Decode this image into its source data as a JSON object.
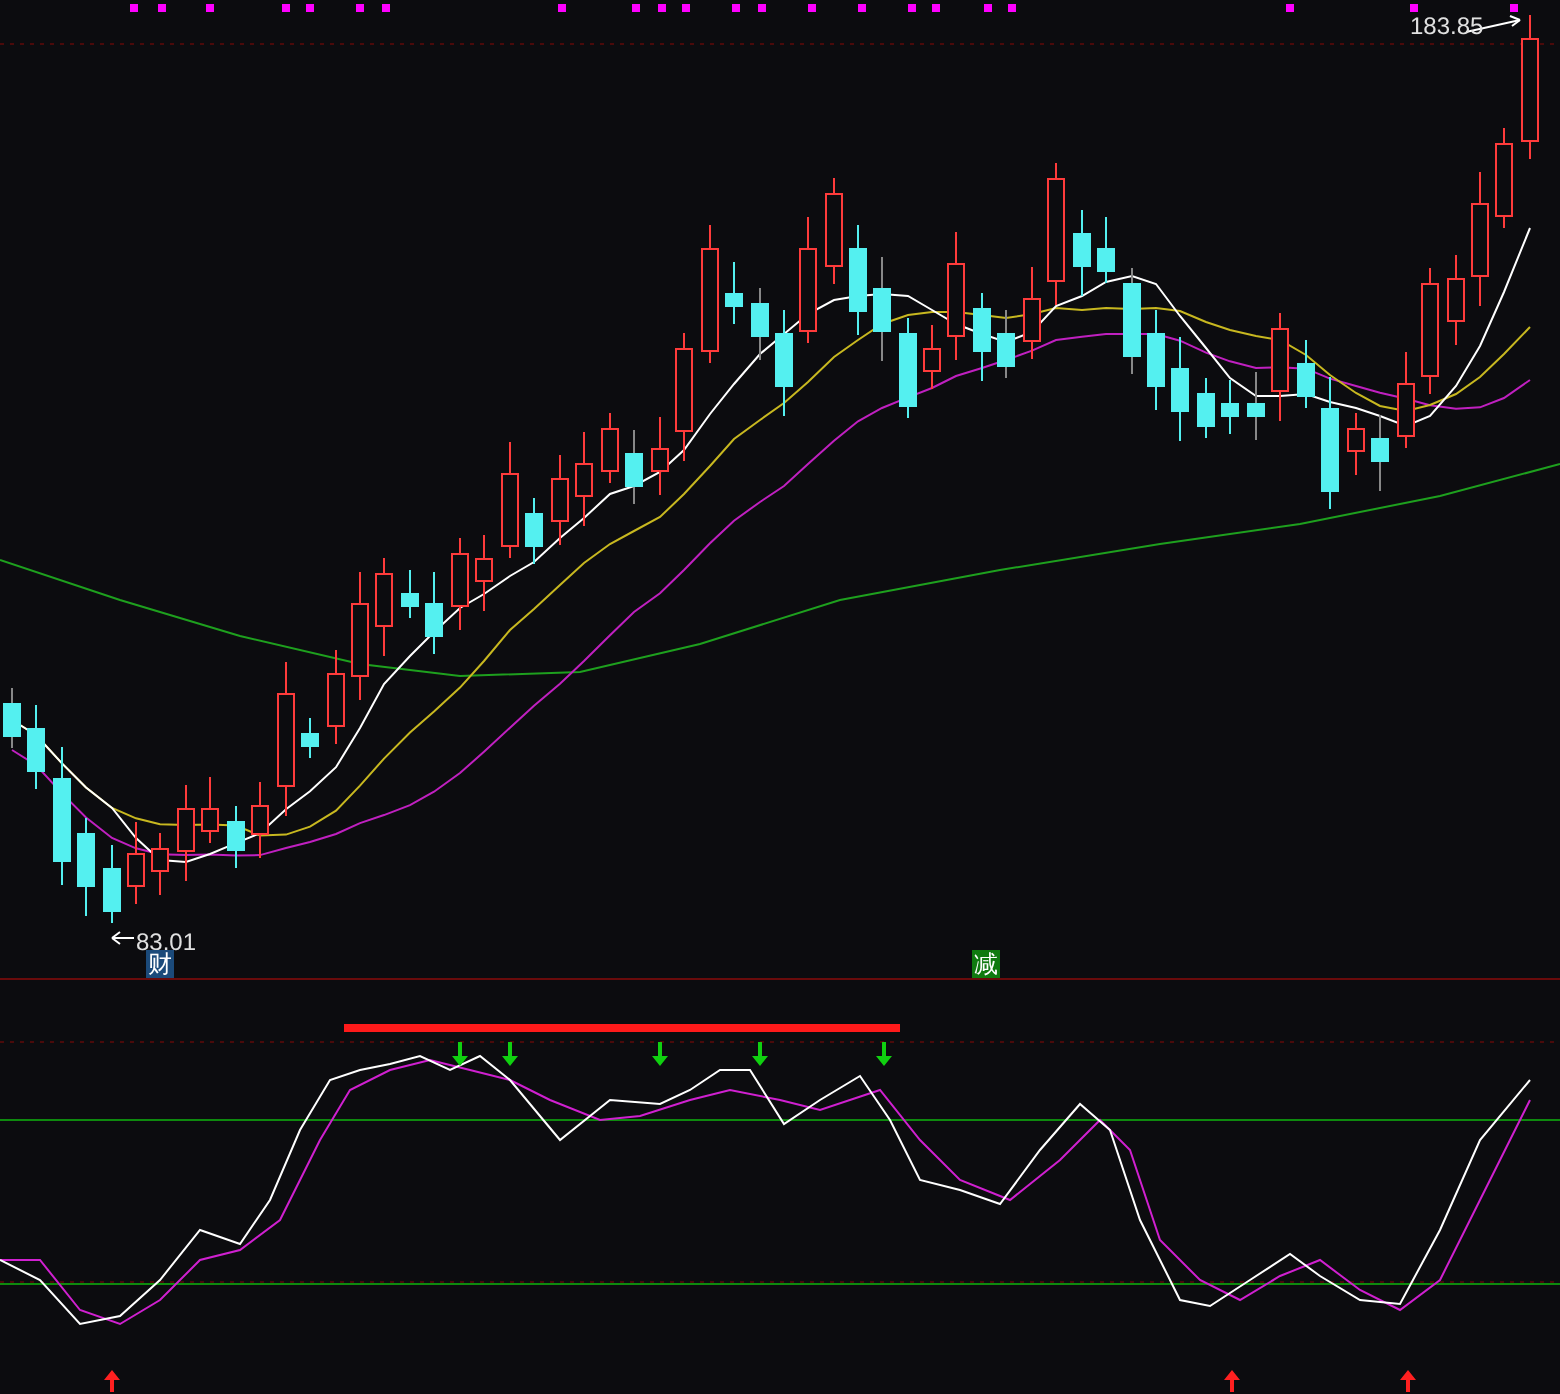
{
  "price_chart": {
    "high_label": "183.85",
    "low_label": "83.01",
    "signals": [
      {
        "text": "财",
        "color": "#1b4a7a"
      },
      {
        "text": "减",
        "color": "#0f7a0f"
      }
    ]
  }
}
